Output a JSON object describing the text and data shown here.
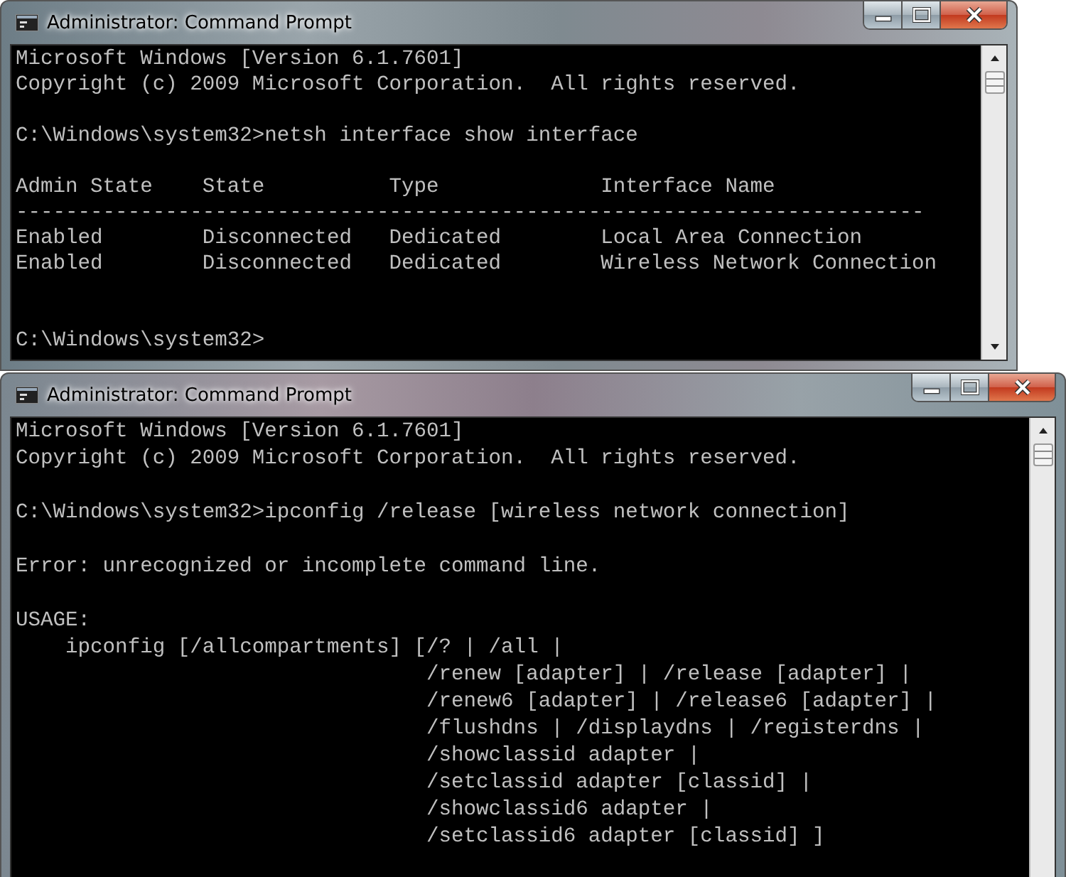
{
  "windows": [
    {
      "title": "Administrator: Command Prompt",
      "blocks": [
        {
          "lines": [
            "Microsoft Windows [Version 6.1.7601]",
            "Copyright (c) 2009 Microsoft Corporation.  All rights reserved."
          ]
        },
        {
          "lines": [
            "C:\\Windows\\system32>netsh interface show interface"
          ]
        },
        {
          "lines": [
            "Admin State    State          Type             Interface Name",
            "-------------------------------------------------------------------------",
            "Enabled        Disconnected   Dedicated        Local Area Connection",
            "Enabled        Disconnected   Dedicated        Wireless Network Connection"
          ]
        },
        {
          "lines": [
            "C:\\Windows\\system32>"
          ]
        }
      ]
    },
    {
      "title": "Administrator: Command Prompt",
      "blocks": [
        {
          "lines": [
            "Microsoft Windows [Version 6.1.7601]",
            "Copyright (c) 2009 Microsoft Corporation.  All rights reserved."
          ]
        },
        {
          "lines": [
            "C:\\Windows\\system32>ipconfig /release [wireless network connection]"
          ]
        },
        {
          "lines": [
            "Error: unrecognized or incomplete command line."
          ]
        },
        {
          "lines": [
            "USAGE:",
            "    ipconfig [/allcompartments] [/? | /all |",
            "                                 /renew [adapter] | /release [adapter] |",
            "                                 /renew6 [adapter] | /release6 [adapter] |",
            "                                 /flushdns | /displaydns | /registerdns |",
            "                                 /showclassid adapter |",
            "                                 /setclassid adapter [classid] |",
            "                                 /showclassid6 adapter |",
            "                                 /setclassid6 adapter [classid] ]"
          ]
        }
      ]
    }
  ]
}
